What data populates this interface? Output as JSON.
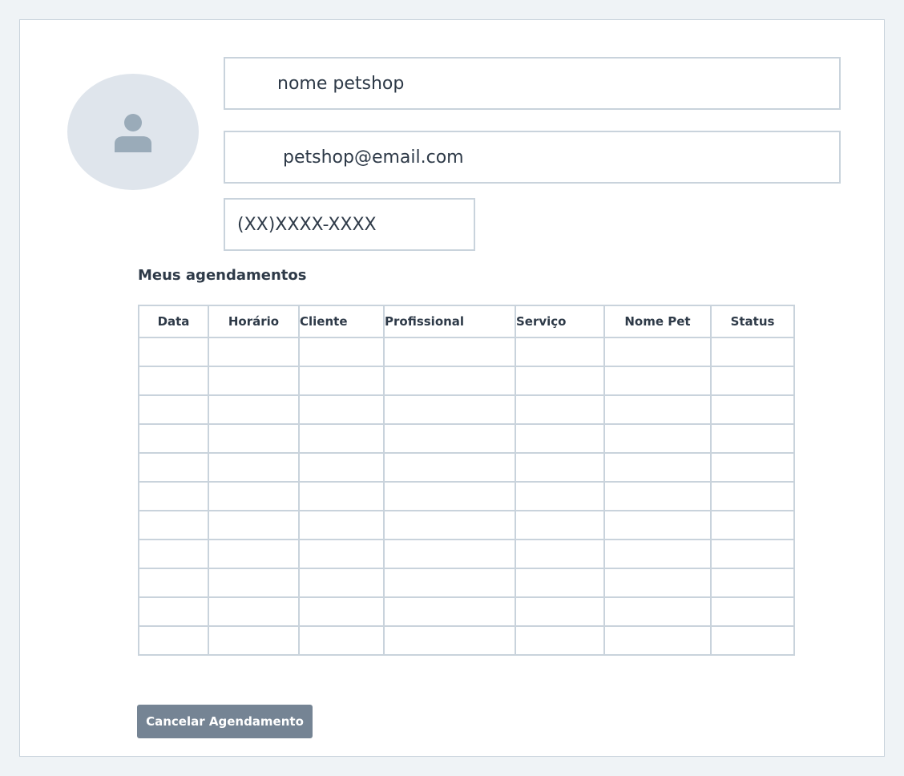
{
  "profile": {
    "avatar_icon": "user-icon",
    "name": "nome petshop",
    "email": "petshop@email.com",
    "phone": "(XX)XXXX-XXXX"
  },
  "appointments": {
    "title": "Meus agendamentos",
    "columns": [
      "Data",
      "Horário",
      "Cliente",
      "Profissional",
      "Serviço",
      "Nome Pet",
      "Status"
    ],
    "rows": [
      [
        "",
        "",
        "",
        "",
        "",
        "",
        ""
      ],
      [
        "",
        "",
        "",
        "",
        "",
        "",
        ""
      ],
      [
        "",
        "",
        "",
        "",
        "",
        "",
        ""
      ],
      [
        "",
        "",
        "",
        "",
        "",
        "",
        ""
      ],
      [
        "",
        "",
        "",
        "",
        "",
        "",
        ""
      ],
      [
        "",
        "",
        "",
        "",
        "",
        "",
        ""
      ],
      [
        "",
        "",
        "",
        "",
        "",
        "",
        ""
      ],
      [
        "",
        "",
        "",
        "",
        "",
        "",
        ""
      ],
      [
        "",
        "",
        "",
        "",
        "",
        "",
        ""
      ],
      [
        "",
        "",
        "",
        "",
        "",
        "",
        ""
      ],
      [
        "",
        "",
        "",
        "",
        "",
        "",
        ""
      ]
    ]
  },
  "actions": {
    "cancel_label": "Cancelar Agendamento"
  },
  "colors": {
    "page_background": "#eff3f6",
    "border": "#c9d3dc",
    "avatar_background": "#dfe5ec",
    "avatar_icon": "#9aabb9",
    "button_background": "#758494",
    "text": "#2e3a48"
  }
}
